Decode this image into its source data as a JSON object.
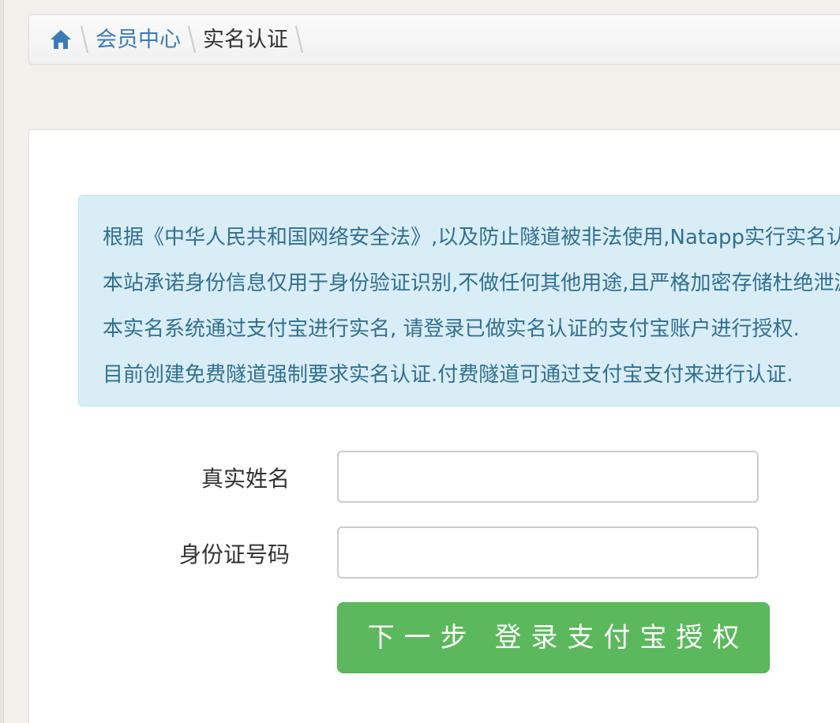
{
  "breadcrumb": {
    "home_icon": "home-icon",
    "items": [
      {
        "label": "会员中心"
      },
      {
        "label": "实名认证"
      }
    ]
  },
  "notice": {
    "lines": [
      "根据《中华人民共和国网络安全法》,以及防止隧道被非法使用,Natapp实行实名认证制度.",
      "本站承诺身份信息仅用于身份验证识别,不做任何其他用途,且严格加密存储杜绝泄漏风险.",
      "本实名系统通过支付宝进行实名, 请登录已做实名认证的支付宝账户进行授权.",
      "目前创建免费隧道强制要求实名认证.付费隧道可通过支付宝支付来进行认证."
    ]
  },
  "form": {
    "name_label": "真实姓名",
    "name_value": "",
    "id_label": "身份证号码",
    "id_value": "",
    "submit_label": "下一步 登录支付宝授权"
  },
  "colors": {
    "accent": "#3a7bb6",
    "notice_bg": "#d9edf7",
    "notice_text": "#31708f",
    "button": "#5cb85c"
  }
}
